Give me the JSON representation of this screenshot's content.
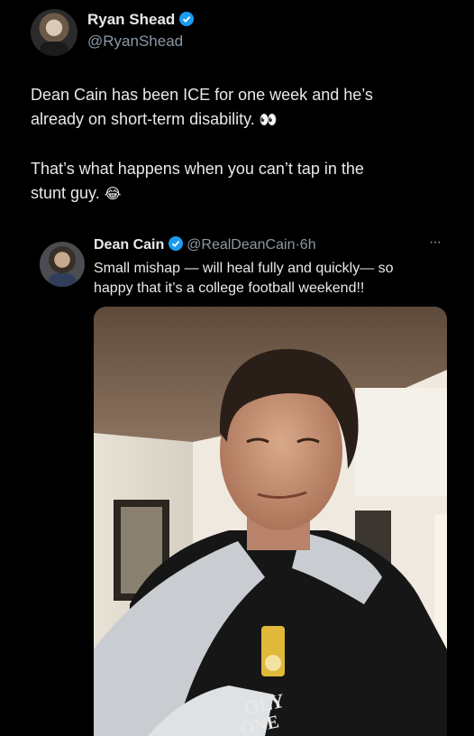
{
  "author": {
    "name": "Ryan Shead",
    "handle": "@RyanShead"
  },
  "tweet": {
    "line1": "Dean Cain has been ICE for one week and he’s",
    "line2": "already on short-term disability.",
    "line2_emoji": "👀",
    "line3": "That’s what happens when you can’t tap in the",
    "line4": "stunt guy.",
    "line4_emoji": "😂"
  },
  "quoted": {
    "name": "Dean Cain",
    "handle": "@RealDeanCain",
    "separator": "·",
    "time": "6h",
    "more": "···",
    "line1": "Small mishap — will heal fully and quickly— so",
    "line2": "happy that it’s a college football weekend!!"
  },
  "media": {
    "shirt_text_1": "OLY",
    "shirt_text_2": "ONE"
  },
  "colors": {
    "background": "#000000",
    "verified": "#1d9bf0",
    "secondary_text": "#8b98a5"
  }
}
